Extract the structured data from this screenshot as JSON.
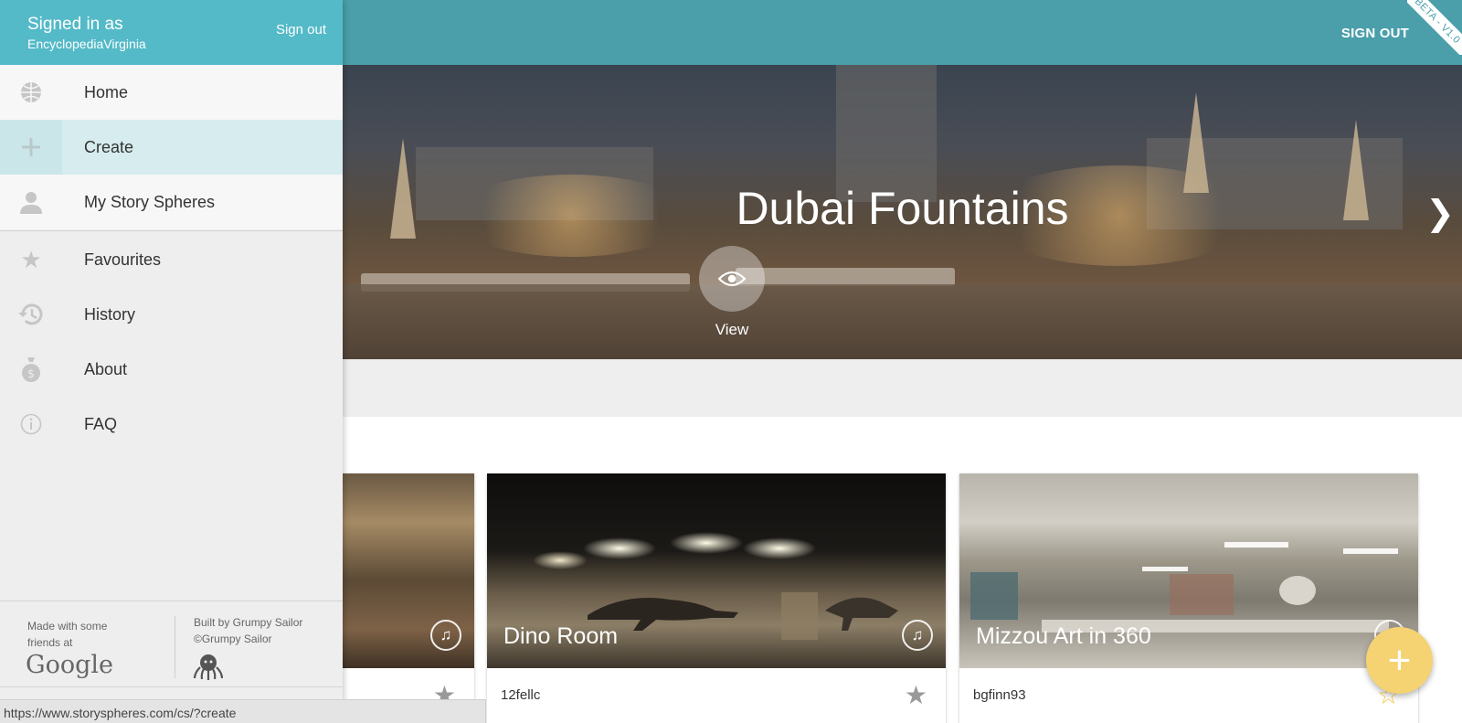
{
  "topbar": {
    "sign_out": "SIGN OUT",
    "beta": "BETA - V1.0"
  },
  "drawer": {
    "signed_in_as": "Signed in as",
    "username": "EncyclopediaVirginia",
    "sign_out": "Sign out",
    "nav_primary": [
      {
        "label": "Home",
        "icon": "globe-icon"
      },
      {
        "label": "Create",
        "icon": "plus-icon",
        "active": true
      },
      {
        "label": "My Story Spheres",
        "icon": "person-icon"
      }
    ],
    "nav_secondary": [
      {
        "label": "Favourites",
        "icon": "star-icon"
      },
      {
        "label": "History",
        "icon": "history-icon"
      },
      {
        "label": "About",
        "icon": "money-bag-icon"
      },
      {
        "label": "FAQ",
        "icon": "info-icon"
      }
    ],
    "footer": {
      "made_with": "Made with some friends at",
      "google": "Google",
      "built_by": "Built by Grumpy Sailor",
      "copyright": "©Grumpy Sailor"
    }
  },
  "hero": {
    "title": "Dubai Fountains",
    "view_label": "View"
  },
  "cards": [
    {
      "title": "",
      "author": ""
    },
    {
      "title": "Dino Room",
      "author": "12fellc"
    },
    {
      "title": "Mizzou Art in 360",
      "author": "bgfinn93"
    }
  ],
  "status_url": "https://www.storyspheres.com/cs/?create",
  "fab": {
    "label": "+"
  },
  "colors": {
    "topbar": "#4a9fab",
    "drawer_header": "#54bac8",
    "fab": "#f5d272",
    "active_nav": "#d6ecee"
  }
}
